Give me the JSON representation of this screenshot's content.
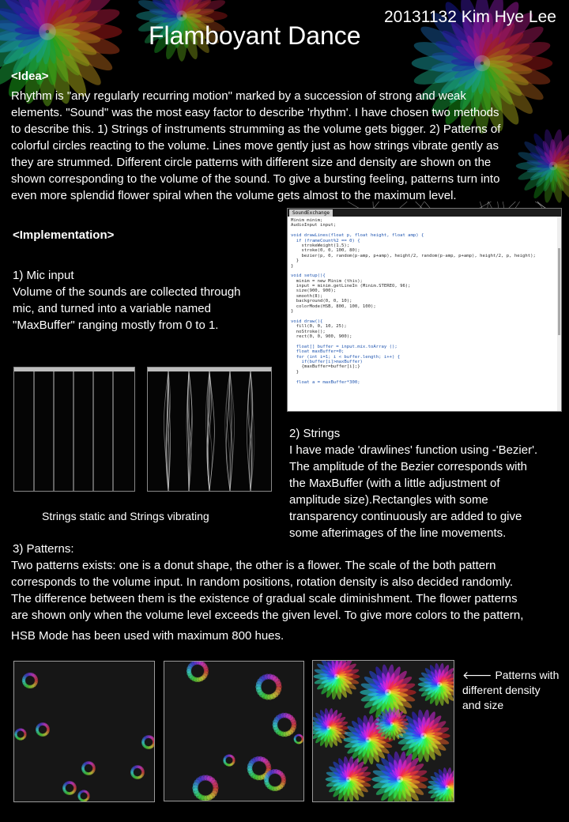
{
  "title": "Flamboyant Dance",
  "author": "20131132 Kim Hye Lee",
  "idea": {
    "heading": "<Idea>",
    "lines": [
      "Rhythm is \"any regularly recurring motion\" marked by a succession of strong and weak",
      "elements. \"Sound\" was the most easy factor to describe 'rhythm'. I have chosen two methods",
      "to describe this. 1) Strings of instruments strumming  as the volume gets bigger. 2) Patterns of",
      "colorful circles reacting to the volume. Lines move gently just as how strings vibrate gently as",
      "they are strummed. Different circle patterns with different size and density are shown on the",
      "shown corresponding to the volume of the sound. To give a bursting feeling, patterns turn into",
      "even more splendid flower spiral when the volume gets almost to the maximum level."
    ]
  },
  "implementation": {
    "heading": "<Implementation>",
    "mic": {
      "heading": "1) Mic input",
      "lines": [
        " Volume of the sounds are collected through",
        "mic, and turned into a variable named",
        "\"MaxBuffer\" ranging mostly from 0 to 1."
      ]
    },
    "strings_caption": "Strings static and Strings vibrating",
    "strings": {
      "heading": "2)  Strings",
      "lines": [
        " I have made 'drawlines' function using -'Bezier'.",
        "The amplitude of the Bezier corresponds with",
        "the MaxBuffer (with a little adjustment of",
        "amplitude size).Rectangles with some",
        "transparency continuously are added to give",
        "some afterimages of the line movements."
      ]
    },
    "code_tab": "SoundExchange",
    "code_lines": [
      "Minim minim;",
      "AudioInput input;",
      "",
      "void drawLines(float p, float height, float amp) {",
      "  if (frameCount%2 == 0) {",
      "    strokeWeight(1.5);",
      "    stroke(0, 0, 100, 80);",
      "    bezier(p, 0, random(p-amp, p+amp), height/2, random(p-amp, p+amp), height/2, p, height);",
      "  }",
      "}",
      "",
      "void setup(){",
      "  minim = new Minim (this);",
      "  input = minim.getLineIn (Minim.STEREO, 96);",
      "  size(900, 900);",
      "  smooth(8);",
      "  background(0, 0, 10);",
      "  colorMode(HSB, 800, 100, 100);",
      "}",
      "",
      "void draw(){",
      "  fill(0, 0, 10, 25);",
      "  noStroke();",
      "  rect(0, 0, 900, 900);",
      "",
      "  float[] buffer = input.mix.toArray ();",
      "  float maxBuffer=0;",
      "  for (int i=1; i < buffer.length; i++) {",
      "    if(buffer[i]>maxBuffer)",
      "    {maxBuffer=buffer[i];}",
      "  }",
      "",
      "  float a = maxBuffer*300;"
    ],
    "patterns": {
      "heading": "3) Patterns:",
      "lines": [
        "Two patterns exists: one is a donut shape, the other is a flower. The scale of the both pattern",
        "corresponds to the volume input. In random positions, rotation density is also decided randomly.",
        "The difference between them is the existence of gradual scale diminishment. The flower patterns",
        "are shown only when the volume level exceeds the given level. To give more colors to the pattern,",
        "HSB Mode has been used with maximum 800 hues."
      ]
    },
    "patterns_caption": {
      "arrow": "🡐",
      "lines": [
        "Patterns with",
        "different density",
        "and size"
      ]
    }
  }
}
